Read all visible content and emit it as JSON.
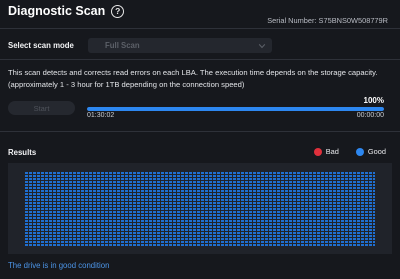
{
  "header": {
    "title": "Diagnostic Scan",
    "help_icon": "help-circle-icon",
    "serial": "Serial Number: S75BNS0W508779R"
  },
  "scan_mode": {
    "label": "Select scan mode",
    "selected": "Full Scan",
    "icon": "chevron-down-icon"
  },
  "description": "This scan detects and corrects read errors on each LBA. The execution time depends on the storage capacity. (approximately 1 - 3 hour for 1TB depending on the connection speed)",
  "controls": {
    "start_label": "Start"
  },
  "progress": {
    "percent_label": "100%",
    "fraction": 1.0,
    "elapsed": "01:30:02",
    "remaining": "00:00:00"
  },
  "results": {
    "label": "Results",
    "legend_bad": "Bad",
    "legend_good": "Good",
    "status": "The drive is in good condition"
  },
  "colors": {
    "accent": "#2d87f0",
    "bad": "#e0303c",
    "good": "#2d87f0",
    "block_good": "#1f6fd1",
    "status_text": "#4c95e8"
  }
}
